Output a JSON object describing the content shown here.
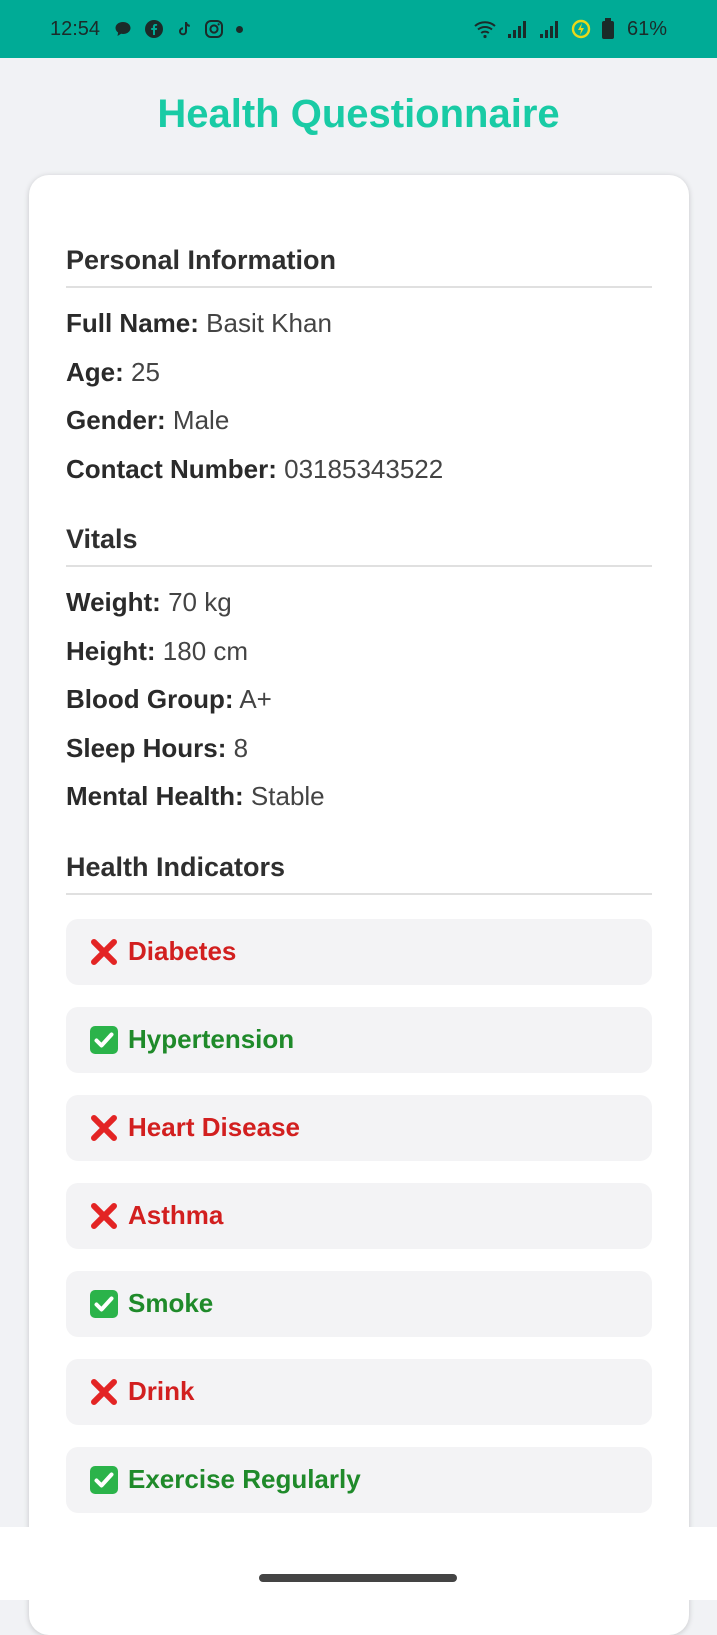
{
  "status_bar": {
    "time": "12:54",
    "battery": "61%",
    "icons": [
      "chat-bubble-icon",
      "facebook-icon",
      "tiktok-icon",
      "instagram-icon",
      "wifi-icon",
      "signal-icon",
      "signal-icon",
      "battery-saver-icon",
      "battery-icon"
    ]
  },
  "title": "Health Questionnaire",
  "colors": {
    "status_bar": "#00ab96",
    "title": "#19cba5",
    "negative": "#d21f1f",
    "positive": "#1f8a2a"
  },
  "personal": {
    "heading": "Personal Information",
    "rows": [
      {
        "label": "Full Name:",
        "value": "Basit Khan"
      },
      {
        "label": "Age:",
        "value": "25"
      },
      {
        "label": "Gender:",
        "value": "Male"
      },
      {
        "label": "Contact Number:",
        "value": "03185343522"
      }
    ]
  },
  "vitals": {
    "heading": "Vitals",
    "rows": [
      {
        "label": "Weight:",
        "value": "70 kg"
      },
      {
        "label": "Height:",
        "value": "180 cm"
      },
      {
        "label": "Blood Group:",
        "value": "A+"
      },
      {
        "label": "Sleep Hours:",
        "value": "8"
      },
      {
        "label": "Mental Health:",
        "value": "Stable"
      }
    ]
  },
  "indicators": {
    "heading": "Health Indicators",
    "items": [
      {
        "label": "Diabetes",
        "status": "no",
        "icon": "cross-mark-icon"
      },
      {
        "label": "Hypertension",
        "status": "yes",
        "icon": "check-mark-icon"
      },
      {
        "label": "Heart Disease",
        "status": "no",
        "icon": "cross-mark-icon"
      },
      {
        "label": "Asthma",
        "status": "no",
        "icon": "cross-mark-icon"
      },
      {
        "label": "Smoke",
        "status": "yes",
        "icon": "check-mark-icon"
      },
      {
        "label": "Drink",
        "status": "no",
        "icon": "cross-mark-icon"
      },
      {
        "label": "Exercise Regularly",
        "status": "yes",
        "icon": "check-mark-icon"
      }
    ]
  }
}
